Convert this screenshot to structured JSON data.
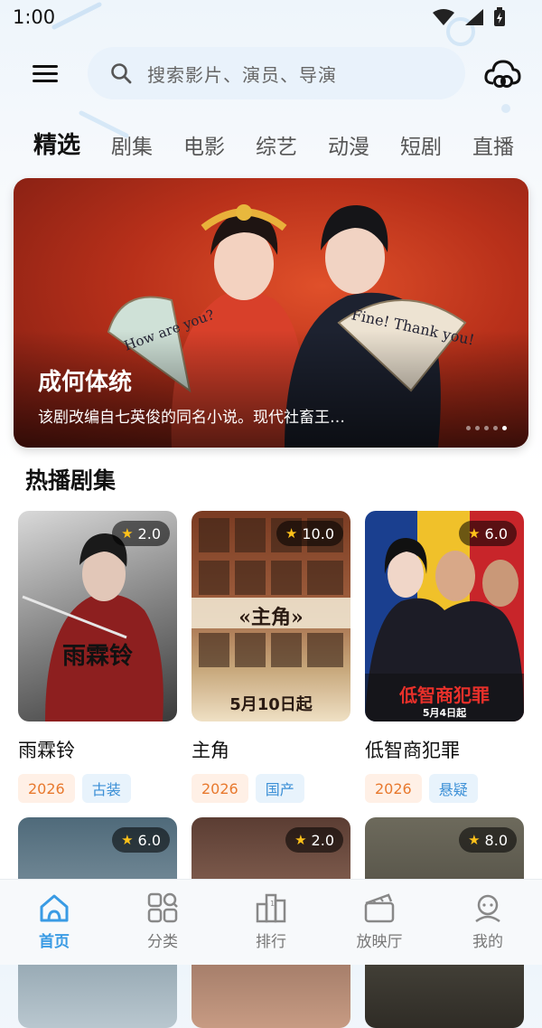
{
  "status_bar": {
    "time": "1:00"
  },
  "search": {
    "placeholder": "搜索影片、演员、导演"
  },
  "tabs": [
    "精选",
    "剧集",
    "电影",
    "综艺",
    "动漫",
    "短剧",
    "直播"
  ],
  "banner": {
    "title": "成何体统",
    "description": "该剧改编自七英俊的同名小说。现代社畜王…",
    "fan_left_text": "How are you?",
    "fan_right_text": "Fine! Thank you!",
    "page_count": 5,
    "active_page": 5
  },
  "section": {
    "title": "热播剧集"
  },
  "shows": [
    {
      "name": "雨霖铃",
      "rating": "2.0",
      "year": "2026",
      "genre": "古装",
      "poster_text": "雨霖铃"
    },
    {
      "name": "主角",
      "rating": "10.0",
      "year": "2026",
      "genre": "国产",
      "poster_text": "«主角»",
      "poster_date": "5月10日起"
    },
    {
      "name": "低智商犯罪",
      "rating": "6.0",
      "year": "2026",
      "genre": "悬疑",
      "poster_text": "低智商犯罪",
      "poster_date": "5月4日起"
    }
  ],
  "more_shows": [
    {
      "rating": "6.0"
    },
    {
      "rating": "2.0"
    },
    {
      "rating": "8.0"
    }
  ],
  "bottom_nav": [
    {
      "label": "首页",
      "icon": "home-icon",
      "active": true
    },
    {
      "label": "分类",
      "icon": "category-icon",
      "active": false
    },
    {
      "label": "排行",
      "icon": "ranking-icon",
      "active": false
    },
    {
      "label": "放映厅",
      "icon": "theater-icon",
      "active": false
    },
    {
      "label": "我的",
      "icon": "profile-icon",
      "active": false
    }
  ],
  "colors": {
    "accent": "#3a9be4",
    "year_tag": "#e8792e",
    "genre_tag": "#3b8fd6",
    "star": "#ffc21a"
  }
}
